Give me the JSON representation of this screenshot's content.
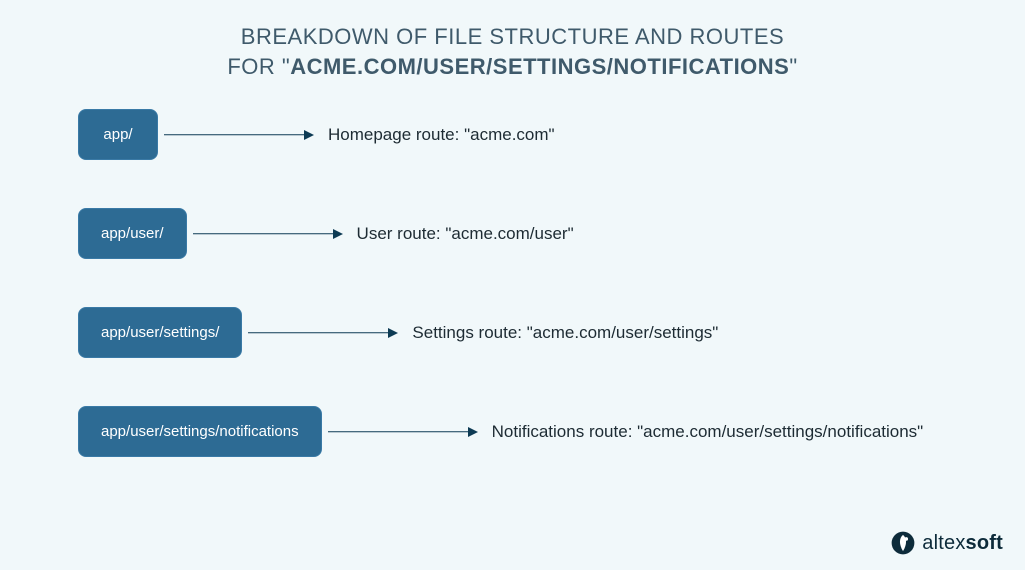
{
  "title": {
    "line1": "BREAKDOWN OF FILE STRUCTURE AND ROUTES",
    "line2_prefix": "FOR \"",
    "line2_bold": "ACME.COM/USER/SETTINGS/NOTIFICATIONS",
    "line2_suffix": "\""
  },
  "rows": [
    {
      "path": "app/",
      "desc": "Homepage route: \"acme.com\""
    },
    {
      "path": "app/user/",
      "desc": "User route: \"acme.com/user\""
    },
    {
      "path": "app/user/settings/",
      "desc": "Settings route: \"acme.com/user/settings\""
    },
    {
      "path": "app/user/settings/notifications",
      "desc": "Notifications route: \"acme.com/user/settings/notifications\""
    }
  ],
  "brand": {
    "part1": "altex",
    "part2": "soft"
  }
}
